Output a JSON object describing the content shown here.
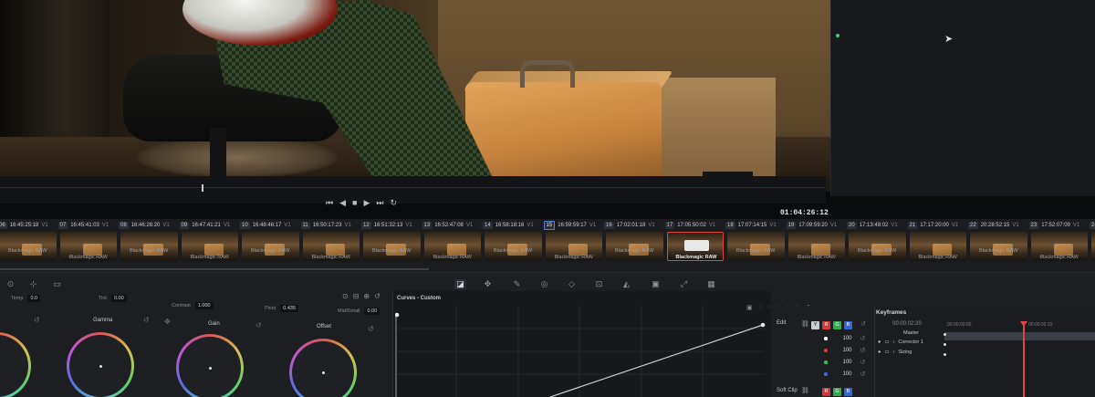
{
  "viewer": {
    "timecode": "01:04:26:12",
    "transport": [
      "⏮",
      "◀",
      "■",
      "▶",
      "⏭",
      "↻"
    ]
  },
  "clips": [
    {
      "num": "06",
      "tc": "16:45:25:18",
      "track": "V1"
    },
    {
      "num": "07",
      "tc": "16:45:41:03",
      "track": "V1"
    },
    {
      "num": "08",
      "tc": "16:46:26:20",
      "track": "V1"
    },
    {
      "num": "09",
      "tc": "16:47:41:21",
      "track": "V1"
    },
    {
      "num": "10",
      "tc": "16:48:46:17",
      "track": "V1"
    },
    {
      "num": "11",
      "tc": "16:50:17:23",
      "track": "V1"
    },
    {
      "num": "12",
      "tc": "16:51:32:13",
      "track": "V1"
    },
    {
      "num": "13",
      "tc": "16:52:47:08",
      "track": "V1"
    },
    {
      "num": "14",
      "tc": "16:58:18:16",
      "track": "V1"
    },
    {
      "num": "15",
      "tc": "16:59:59:17",
      "track": "V1"
    },
    {
      "num": "16",
      "tc": "17:02:01:18",
      "track": "V1"
    },
    {
      "num": "17",
      "tc": "17:05:50:02",
      "track": "V1"
    },
    {
      "num": "18",
      "tc": "17:07:14:15",
      "track": "V1"
    },
    {
      "num": "19",
      "tc": "17:09:59:20",
      "track": "V1"
    },
    {
      "num": "20",
      "tc": "17:13:48:02",
      "track": "V1"
    },
    {
      "num": "21",
      "tc": "17:17:20:00",
      "track": "V1"
    },
    {
      "num": "22",
      "tc": "20:28:52:15",
      "track": "V1"
    },
    {
      "num": "23",
      "tc": "17:52:07:09",
      "track": "V1"
    },
    {
      "num": "24",
      "tc": "",
      "track": "V1"
    }
  ],
  "clip_caption": "Blackmagic RAW",
  "primaries": {
    "temp_label": "Temp",
    "temp_value": "0.0",
    "tint_label": "Tint",
    "tint_value": "0.00",
    "contrast_label": "Contrast",
    "contrast_value": "1.000",
    "pivot_label": "Pivot",
    "pivot_value": "0.435",
    "middetail_label": "Mid/Detail",
    "middetail_value": "0.00",
    "wheels": [
      "Gamma",
      "Gain",
      "Offset"
    ]
  },
  "curves": {
    "title": "Curves - Custom"
  },
  "edit": {
    "title": "Edit",
    "channels": [
      "Y",
      "R",
      "G",
      "B"
    ],
    "channel_colors": [
      "#c9ccd2",
      "#d23a3a",
      "#2fae4a",
      "#3366d6"
    ],
    "rows": [
      {
        "color": "#ffffff",
        "value": "100"
      },
      {
        "color": "#e0392f",
        "value": "100"
      },
      {
        "color": "#2fc24c",
        "value": "100"
      },
      {
        "color": "#3a6fe0",
        "value": "100"
      }
    ],
    "soft_clip": "Soft Clip"
  },
  "keyframes": {
    "title": "Keyframes",
    "timecode": "00:00:02:20",
    "ruler_start": "00:00:00:00",
    "ruler_mid": "00:00:03:10",
    "tracks": [
      "Master",
      "Corrector 1",
      "Sizing"
    ]
  }
}
